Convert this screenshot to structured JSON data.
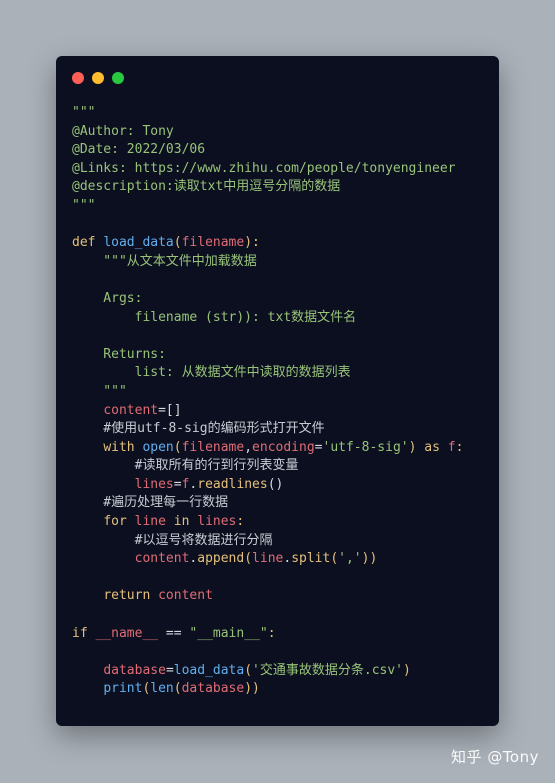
{
  "colors": {
    "background": "#aab1b9",
    "card": "#0b0f1f",
    "default": "#d7dae0",
    "comment": "#c8ccd4",
    "docstring": "#98c379",
    "keyword": "#e5c07b",
    "function": "#61afef",
    "variable": "#e06c75",
    "string": "#98c379",
    "operator": "#e5c07b",
    "property": "#e5c07b"
  },
  "window_controls": [
    {
      "name": "close",
      "color": "#ff5f57"
    },
    {
      "name": "minimize",
      "color": "#febc2e"
    },
    {
      "name": "maximize",
      "color": "#28c840"
    }
  ],
  "code_lines": [
    [
      {
        "t": "\"\"\"",
        "c": "docstring"
      }
    ],
    [
      {
        "t": "@Author: Tony",
        "c": "docstring"
      }
    ],
    [
      {
        "t": "@Date: 2022/03/06",
        "c": "docstring"
      }
    ],
    [
      {
        "t": "@Links: https://www.zhihu.com/people/tonyengineer",
        "c": "docstring"
      }
    ],
    [
      {
        "t": "@description:读取txt中用逗号分隔的数据",
        "c": "docstring"
      }
    ],
    [
      {
        "t": "\"\"\"",
        "c": "docstring"
      }
    ],
    [],
    [
      {
        "t": "def ",
        "c": "keyword"
      },
      {
        "t": "load_data",
        "c": "function"
      },
      {
        "t": "(",
        "c": "keyword"
      },
      {
        "t": "filename",
        "c": "variable"
      },
      {
        "t": "):",
        "c": "keyword"
      }
    ],
    [
      {
        "t": "    \"\"\"从文本文件中加载数据",
        "c": "docstring"
      }
    ],
    [],
    [
      {
        "t": "    Args:",
        "c": "docstring"
      }
    ],
    [
      {
        "t": "        filename (str)): txt数据文件名",
        "c": "docstring"
      }
    ],
    [],
    [
      {
        "t": "    Returns:",
        "c": "docstring"
      }
    ],
    [
      {
        "t": "        list: 从数据文件中读取的数据列表",
        "c": "docstring"
      }
    ],
    [
      {
        "t": "    \"\"\"",
        "c": "docstring"
      }
    ],
    [
      {
        "t": "    ",
        "c": "default"
      },
      {
        "t": "content",
        "c": "variable"
      },
      {
        "t": "=[]",
        "c": "default"
      }
    ],
    [
      {
        "t": "    #使用utf-8-sig的编码形式打开文件",
        "c": "comment"
      }
    ],
    [
      {
        "t": "    ",
        "c": "default"
      },
      {
        "t": "with ",
        "c": "keyword"
      },
      {
        "t": "open",
        "c": "function"
      },
      {
        "t": "(",
        "c": "keyword"
      },
      {
        "t": "filename",
        "c": "variable"
      },
      {
        "t": ",",
        "c": "default"
      },
      {
        "t": "encoding",
        "c": "variable"
      },
      {
        "t": "=",
        "c": "default"
      },
      {
        "t": "'utf-8-sig'",
        "c": "string"
      },
      {
        "t": ") ",
        "c": "keyword"
      },
      {
        "t": "as ",
        "c": "keyword"
      },
      {
        "t": "f",
        "c": "variable"
      },
      {
        "t": ":",
        "c": "keyword"
      }
    ],
    [
      {
        "t": "        #读取所有的行到行列表变量",
        "c": "comment"
      }
    ],
    [
      {
        "t": "        ",
        "c": "default"
      },
      {
        "t": "lines",
        "c": "variable"
      },
      {
        "t": "=",
        "c": "default"
      },
      {
        "t": "f",
        "c": "variable"
      },
      {
        "t": ".",
        "c": "default"
      },
      {
        "t": "readlines",
        "c": "property"
      },
      {
        "t": "()",
        "c": "default"
      }
    ],
    [
      {
        "t": "    #遍历处理每一行数据",
        "c": "comment"
      }
    ],
    [
      {
        "t": "    ",
        "c": "default"
      },
      {
        "t": "for ",
        "c": "keyword"
      },
      {
        "t": "line ",
        "c": "variable"
      },
      {
        "t": "in ",
        "c": "keyword"
      },
      {
        "t": "lines",
        "c": "variable"
      },
      {
        "t": ":",
        "c": "keyword"
      }
    ],
    [
      {
        "t": "        #以逗号将数据进行分隔",
        "c": "comment"
      }
    ],
    [
      {
        "t": "        ",
        "c": "default"
      },
      {
        "t": "content",
        "c": "variable"
      },
      {
        "t": ".",
        "c": "default"
      },
      {
        "t": "append",
        "c": "property"
      },
      {
        "t": "(",
        "c": "keyword"
      },
      {
        "t": "line",
        "c": "variable"
      },
      {
        "t": ".",
        "c": "default"
      },
      {
        "t": "split",
        "c": "property"
      },
      {
        "t": "(",
        "c": "keyword"
      },
      {
        "t": "','",
        "c": "string"
      },
      {
        "t": "))",
        "c": "keyword"
      }
    ],
    [],
    [
      {
        "t": "    ",
        "c": "default"
      },
      {
        "t": "return ",
        "c": "keyword"
      },
      {
        "t": "content",
        "c": "variable"
      }
    ],
    [],
    [
      {
        "t": "if ",
        "c": "keyword"
      },
      {
        "t": "__name__",
        "c": "variable"
      },
      {
        "t": " == ",
        "c": "default"
      },
      {
        "t": "\"__main__\"",
        "c": "string"
      },
      {
        "t": ":",
        "c": "keyword"
      }
    ],
    [],
    [
      {
        "t": "    ",
        "c": "default"
      },
      {
        "t": "database",
        "c": "variable"
      },
      {
        "t": "=",
        "c": "default"
      },
      {
        "t": "load_data",
        "c": "function"
      },
      {
        "t": "(",
        "c": "keyword"
      },
      {
        "t": "'交通事故数据分条.csv'",
        "c": "string"
      },
      {
        "t": ")",
        "c": "keyword"
      }
    ],
    [
      {
        "t": "    ",
        "c": "default"
      },
      {
        "t": "print",
        "c": "function"
      },
      {
        "t": "(",
        "c": "keyword"
      },
      {
        "t": "len",
        "c": "function"
      },
      {
        "t": "(",
        "c": "keyword"
      },
      {
        "t": "database",
        "c": "variable"
      },
      {
        "t": "))",
        "c": "keyword"
      }
    ]
  ],
  "watermark": "知乎 @Tony"
}
